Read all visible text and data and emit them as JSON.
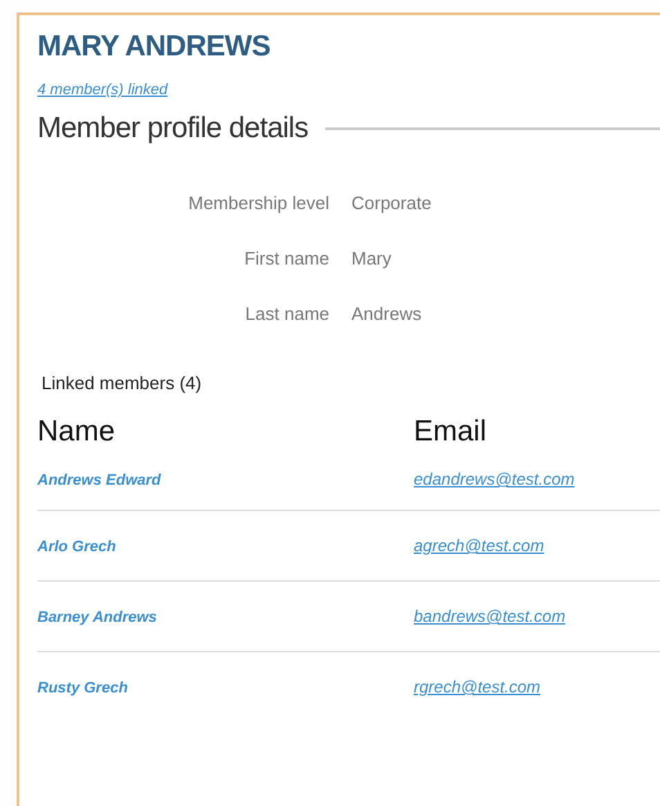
{
  "member": {
    "name": "MARY ANDREWS",
    "linked_link": "4 member(s) linked"
  },
  "profile": {
    "heading": "Member profile details",
    "fields": [
      {
        "label": "Membership level",
        "value": "Corporate"
      },
      {
        "label": "First name",
        "value": "Mary"
      },
      {
        "label": "Last name",
        "value": "Andrews"
      }
    ]
  },
  "linked": {
    "title": "Linked members (4)",
    "columns": [
      "Name",
      "Email"
    ],
    "rows": [
      {
        "name": "Andrews Edward",
        "email": "edandrews@test.com"
      },
      {
        "name": "Arlo Grech",
        "email": "agrech@test.com"
      },
      {
        "name": "Barney Andrews",
        "email": "bandrews@test.com"
      },
      {
        "name": "Rusty Grech",
        "email": "rgrech@test.com"
      }
    ]
  }
}
